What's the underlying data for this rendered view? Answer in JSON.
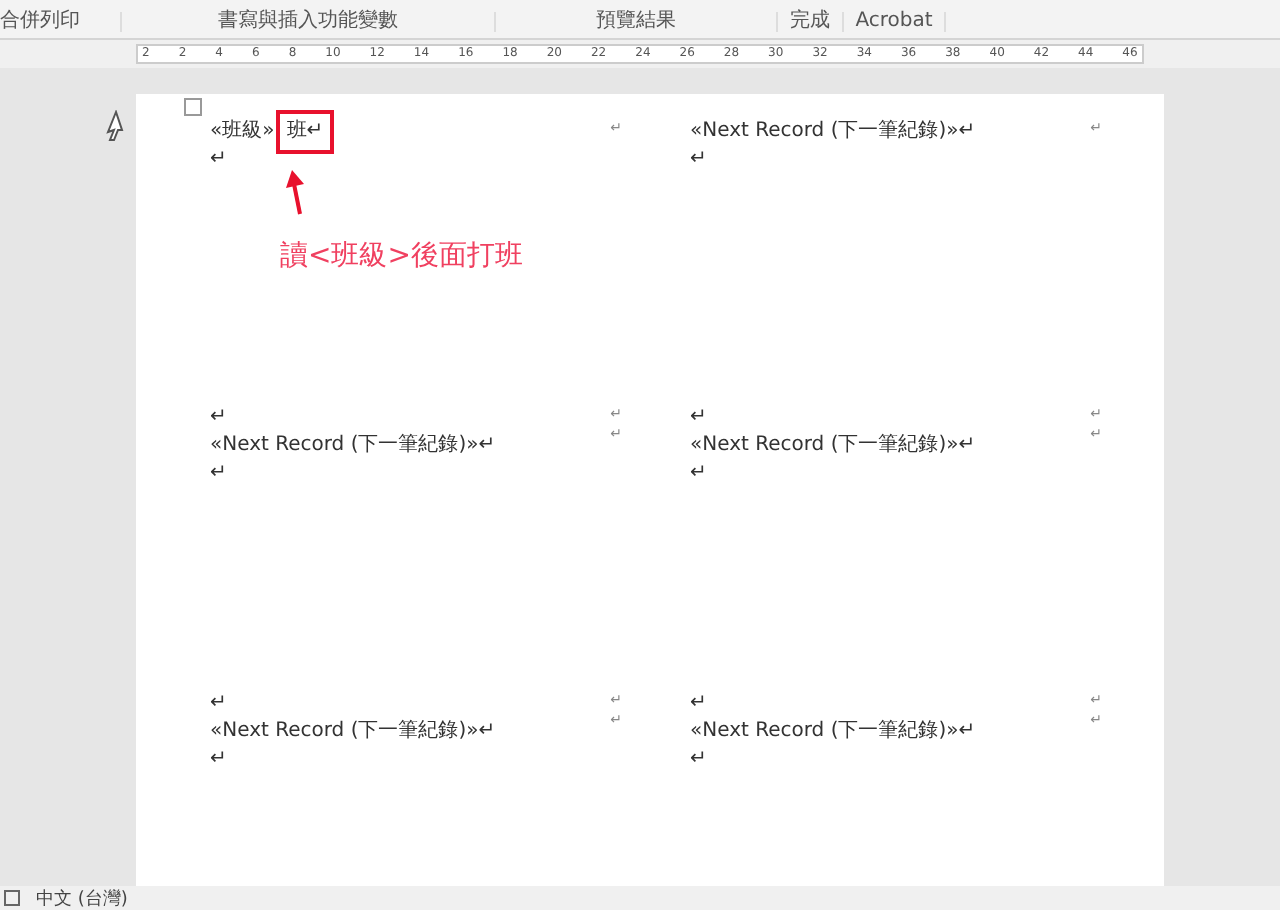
{
  "ribbon": {
    "groups": [
      {
        "label": "合併列印"
      },
      {
        "label": "書寫與插入功能變數"
      },
      {
        "label": "預覽結果"
      },
      {
        "label": "完成"
      },
      {
        "label": "Acrobat"
      }
    ]
  },
  "ruler": {
    "ticks": [
      "2",
      "2",
      "4",
      "6",
      "8",
      "10",
      "12",
      "14",
      "16",
      "18",
      "20",
      "22",
      "24",
      "26",
      "28",
      "30",
      "32",
      "34",
      "36",
      "38",
      "40",
      "42",
      "44",
      "46"
    ]
  },
  "labels": [
    {
      "lines": [
        "«班級»",
        "↵"
      ],
      "highlight": "班↵",
      "end_marks": [
        "↵"
      ]
    },
    {
      "lines": [
        "«Next Record (下一筆紀錄)»↵",
        "↵"
      ],
      "end_marks": [
        "↵"
      ]
    },
    {
      "lines": [
        "↵",
        "«Next Record (下一筆紀錄)»↵",
        "↵"
      ],
      "end_marks": [
        "↵",
        "↵"
      ]
    },
    {
      "lines": [
        "↵",
        "«Next Record (下一筆紀錄)»↵",
        "↵"
      ],
      "end_marks": [
        "↵",
        "↵"
      ]
    },
    {
      "lines": [
        "↵",
        "«Next Record (下一筆紀錄)»↵",
        "↵"
      ],
      "end_marks": [
        "↵",
        "↵"
      ]
    },
    {
      "lines": [
        "↵",
        "«Next Record (下一筆紀錄)»↵",
        "↵"
      ],
      "end_marks": [
        "↵",
        "↵"
      ]
    }
  ],
  "annotation": {
    "text": "讀<班級>後面打班"
  },
  "status_bar": {
    "language": "中文 (台灣)"
  }
}
